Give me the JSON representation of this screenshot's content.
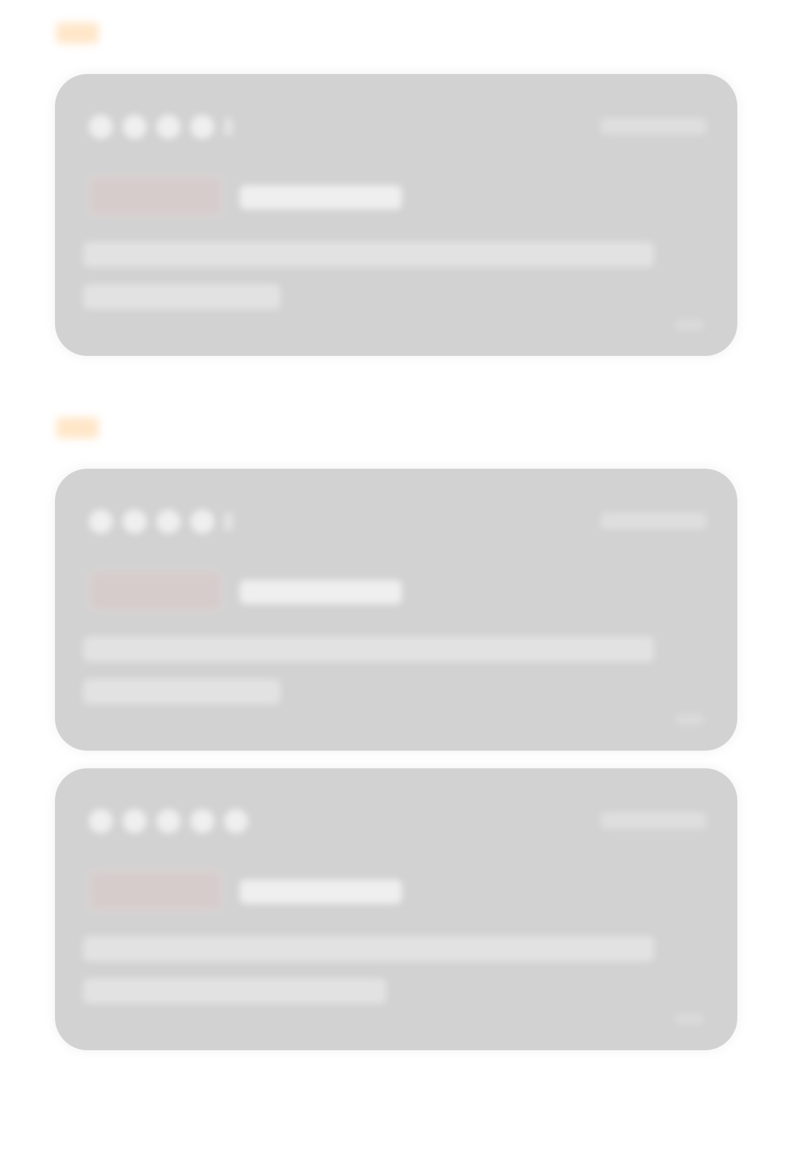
{
  "colors": {
    "page_background": "#ffffff",
    "card_background": "#d2d2d2",
    "section_accent": "#ffe2bf",
    "star_filled": "#efefef",
    "tag_tint": "#d6cccc"
  },
  "sections": [
    {
      "reviews": [
        {
          "rating": 4,
          "max_rating": 5
        }
      ]
    },
    {
      "reviews": [
        {
          "rating": 4,
          "max_rating": 5
        },
        {
          "rating": 5,
          "max_rating": 5
        }
      ]
    }
  ]
}
